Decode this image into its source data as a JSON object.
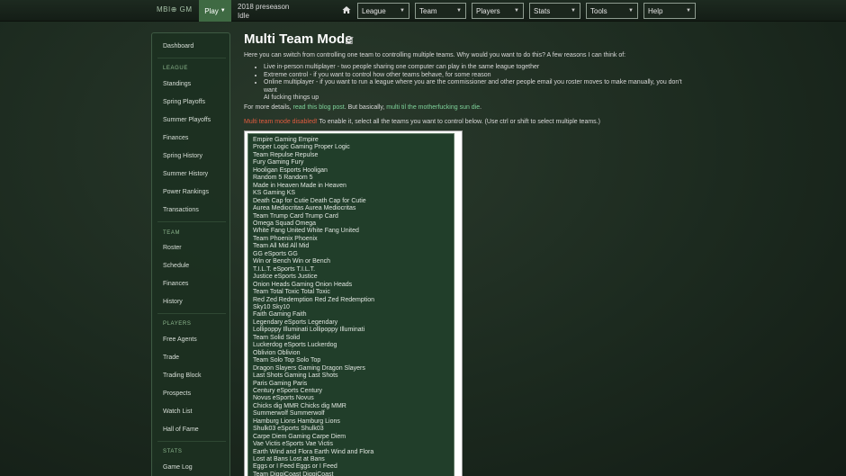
{
  "navbar": {
    "brand": "MBI⊕ GM",
    "play_label": "Play",
    "season_line1": "2018 preseason",
    "season_line2": "Idle",
    "menus": [
      "League",
      "Team",
      "Players",
      "Stats",
      "Tools",
      "Help"
    ]
  },
  "sidebar": {
    "top": [
      "Dashboard"
    ],
    "league_head": "LEAGUE",
    "league": [
      "Standings",
      "Spring Playoffs",
      "Summer Playoffs",
      "Finances",
      "Spring History",
      "Summer History",
      "Power Rankings",
      "Transactions"
    ],
    "team_head": "TEAM",
    "team": [
      "Roster",
      "Schedule",
      "Finances",
      "History"
    ],
    "players_head": "PLAYERS",
    "players": [
      "Free Agents",
      "Trade",
      "Trading Block",
      "Prospects",
      "Watch List",
      "Hall of Fame"
    ],
    "stats_head": "STATS",
    "stats": [
      "Game Log"
    ]
  },
  "main": {
    "title": "Multi Team Mode",
    "intro": "Here you can switch from controlling one team to controlling multiple teams. Why would you want to do this? A few reasons I can think of:",
    "bullet1": "Live in-person multiplayer - two people sharing one computer can play in the same league together",
    "bullet2": "Extreme control - if you want to control how other teams behave, for some reason",
    "bullet3_line1": "Online multiplayer - if you want to run a league where you are the commissioner and other people email you roster moves to make manually, you don't want",
    "bullet3_line2": "AI fucking things up",
    "details_prefix": "For more details,",
    "details_link1": "read this blog post",
    "details_mid": ". But basically,",
    "details_link2": "multi til the motherfucking sun die",
    "details_suffix": ".",
    "status_warn": "Multi team mode disabled!",
    "status_rest": " To enable it, select all the teams you want to control below. (Use ctrl or shift to select multiple teams.)"
  },
  "teams": [
    "Empire Gaming Empire",
    "Proper Logic Gaming Proper Logic",
    "Team Repulse Repulse",
    "Fury Gaming Fury",
    "Hooligan Esports Hooligan",
    "Random 5 Random 5",
    "Made in Heaven Made in Heaven",
    "KS Gaming KS",
    "Death Cap for Cutie Death Cap for Cutie",
    "Aurea Mediocritas Aurea Mediocritas",
    "Team Trump Card Trump Card",
    "Omega Squad Omega",
    "White Fang United White Fang United",
    "Team Phoenix Phoenix",
    "Team All Mid All Mid",
    "GG eSports GG",
    "Win or Bench Win or Bench",
    "T.I.L.T. eSports T.I.L.T.",
    "Justice eSports Justice",
    "Onion Heads Gaming Onion Heads",
    "Team Total Toxic Total Toxic",
    "Red Zed Redemption Red Zed Redemption",
    "Sky10 Sky10",
    "Faith Gaming Faith",
    "Legendary eSports Legendary",
    "Lollipoppy Illuminati Lollipoppy Illuminati",
    "Team Solid Solid",
    "Luckerdog eSports Luckerdog",
    "Oblivion Oblivion",
    "Team Solo Top Solo Top",
    "Dragon Slayers Gaming Dragon Slayers",
    "Last Shots Gaming Last Shots",
    "Paris Gaming Paris",
    "Century eSports Century",
    "Novus eSports Novus",
    "Chicks dig MMR Chicks dig MMR",
    "Summerwolf Summerwolf",
    "Hamburg Lions Hamburg Lions",
    "Shulk03 eSports Shulk03",
    "Carpe Diem Gaming Carpe Diem",
    "Vae Victis eSports Vae Victis",
    "Earth Wind and Flora Earth Wind and Flora",
    "Lost at Bans Lost at Bans",
    "Eggs or I Feed Eggs or I Feed",
    "Team DiggiCoast DiggiCoast"
  ]
}
